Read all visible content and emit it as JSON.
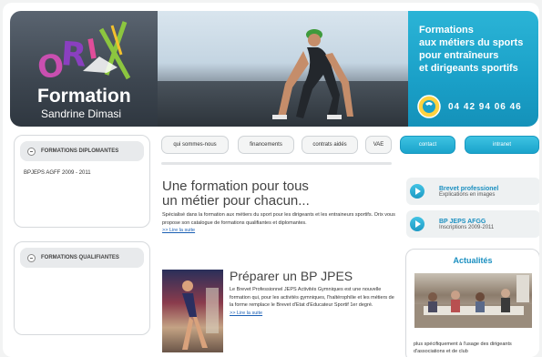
{
  "header": {
    "brand_name": "Formation",
    "brand_sub": "Sandrine Dimasi",
    "logo_letters": "ORIX",
    "tagline_lines": [
      "Formations",
      "aux métiers du sports",
      "pour entraîneurs",
      "et dirigeants sportifs"
    ],
    "phone": "04 42 94 06 46"
  },
  "nav": {
    "items": [
      "qui sommes-nous",
      "financements",
      "contrats aidés",
      "VAE"
    ],
    "buttons": [
      "contact",
      "intranet"
    ]
  },
  "sidebar": {
    "box1_title": "FORMATIONS DIPLOMANTES",
    "box1_item": "BPJEPS AGFF 2009 - 2011",
    "box2_title": "FORMATIONS QUALIFIANTES"
  },
  "main": {
    "heading_line1": "Une formation pour tous",
    "heading_line2": "un métier pour chacun...",
    "intro_text": "Spécialisé dans la formation aux métiers du sport pour les dirigeants et les entraineurs sportifs. Orix vous propose son catalogue de formations qualifiantes et diplomantes.",
    "intro_more": ">> Lire la suite",
    "bp_heading": "Préparer un BP JPES",
    "bp_text": "Le Brevet Professionnel JEPS Activités Gymniques est une nouvelle formation qui, pour les activités gymniques, l'haltérophilie et les métiers de la forme remplace le Brevet d'Etat d'Educateur Sportif 1er degré.",
    "bp_more": ">> Lire la suite"
  },
  "right": {
    "promo1_title": "Brevet professionel",
    "promo1_sub": "Explications en images",
    "promo2_title": "BP JEPS AFGG",
    "promo2_sub": "Inscriptions 2009-2011",
    "actu_title": "Actualités",
    "actu_text": "plus spécifiquement à l'usage des dirigeants d'associations et de club"
  },
  "colors": {
    "accent": "#1aa3cb",
    "header_dark": "#3d4650",
    "link": "#1a5fb4"
  }
}
